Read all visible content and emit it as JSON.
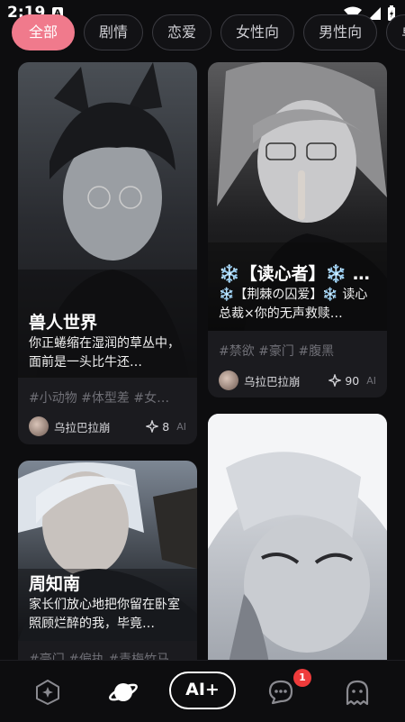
{
  "status_bar": {
    "time": "2:19",
    "sim_label": "A"
  },
  "tabs": [
    {
      "label": "全部",
      "active": true
    },
    {
      "label": "剧情"
    },
    {
      "label": "恋爱"
    },
    {
      "label": "女性向"
    },
    {
      "label": "男性向"
    },
    {
      "label": "单"
    }
  ],
  "cards": [
    {
      "title": "兽人世界",
      "description": "你正蜷缩在湿润的草丛中，面前是一头比牛还…",
      "tags": "#小动物 #体型差 #女…",
      "author": "乌拉巴拉崩",
      "likes": "8",
      "ai_label": "AI"
    },
    {
      "title": "❄️【读心者】❄️ …",
      "description": "❄️【荆棘の囚爱】❄️ 读心总裁×你的无声救赎…",
      "tags": "#禁欲 #豪门 #腹黑",
      "author": "乌拉巴拉崩",
      "likes": "90",
      "ai_label": "AI"
    },
    {
      "title": "周知南",
      "description": "家长们放心地把你留在卧室照顾烂醉的我，毕竟…",
      "tags": "#豪门 #偏执 #青梅竹马",
      "author": "",
      "likes": "",
      "ai_label": ""
    },
    {
      "title": "",
      "description": "",
      "tags": ""
    }
  ],
  "bottom_nav": {
    "ai_button_label": "AI+",
    "message_badge": "1"
  },
  "colors": {
    "accent": "#f07a8c",
    "badge": "#ef3b3b",
    "background": "#0d0d0f"
  }
}
